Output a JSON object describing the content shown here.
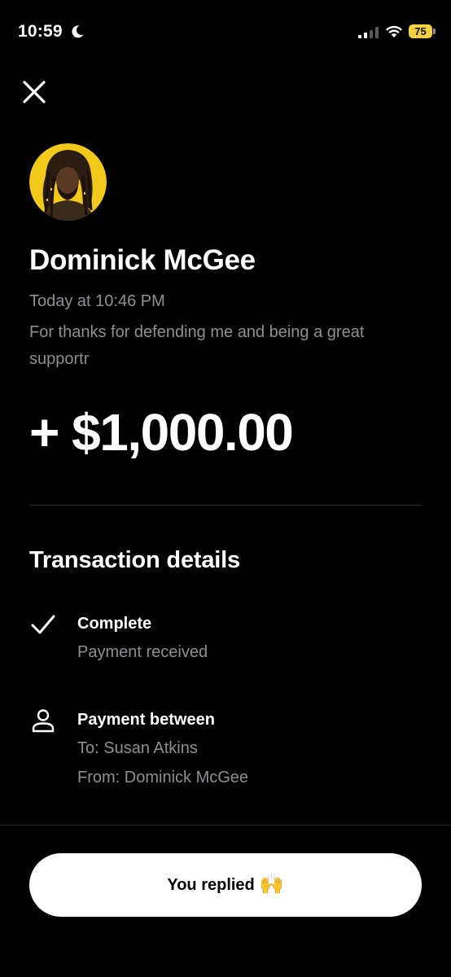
{
  "status_bar": {
    "time": "10:59",
    "battery": "75"
  },
  "header": {
    "close_icon": "close-icon"
  },
  "payment": {
    "sender_name": "Dominick McGee",
    "timestamp": "Today at 10:46 PM",
    "note": "For thanks for defending me and being a great supportr",
    "amount": "+ $1,000.00"
  },
  "details": {
    "title": "Transaction details",
    "status": {
      "icon": "check-icon",
      "title": "Complete",
      "subtitle": "Payment received"
    },
    "between": {
      "icon": "person-icon",
      "title": "Payment between",
      "to": "To: Susan Atkins",
      "from": "From: Dominick McGee"
    }
  },
  "footer": {
    "reply_label": "You replied",
    "reply_emoji": "🙌"
  },
  "colors": {
    "background": "#000000",
    "secondary_text": "#8e8e93",
    "avatar_background": "#f2c81b",
    "battery": "#f5d142",
    "button": "#ffffff"
  }
}
